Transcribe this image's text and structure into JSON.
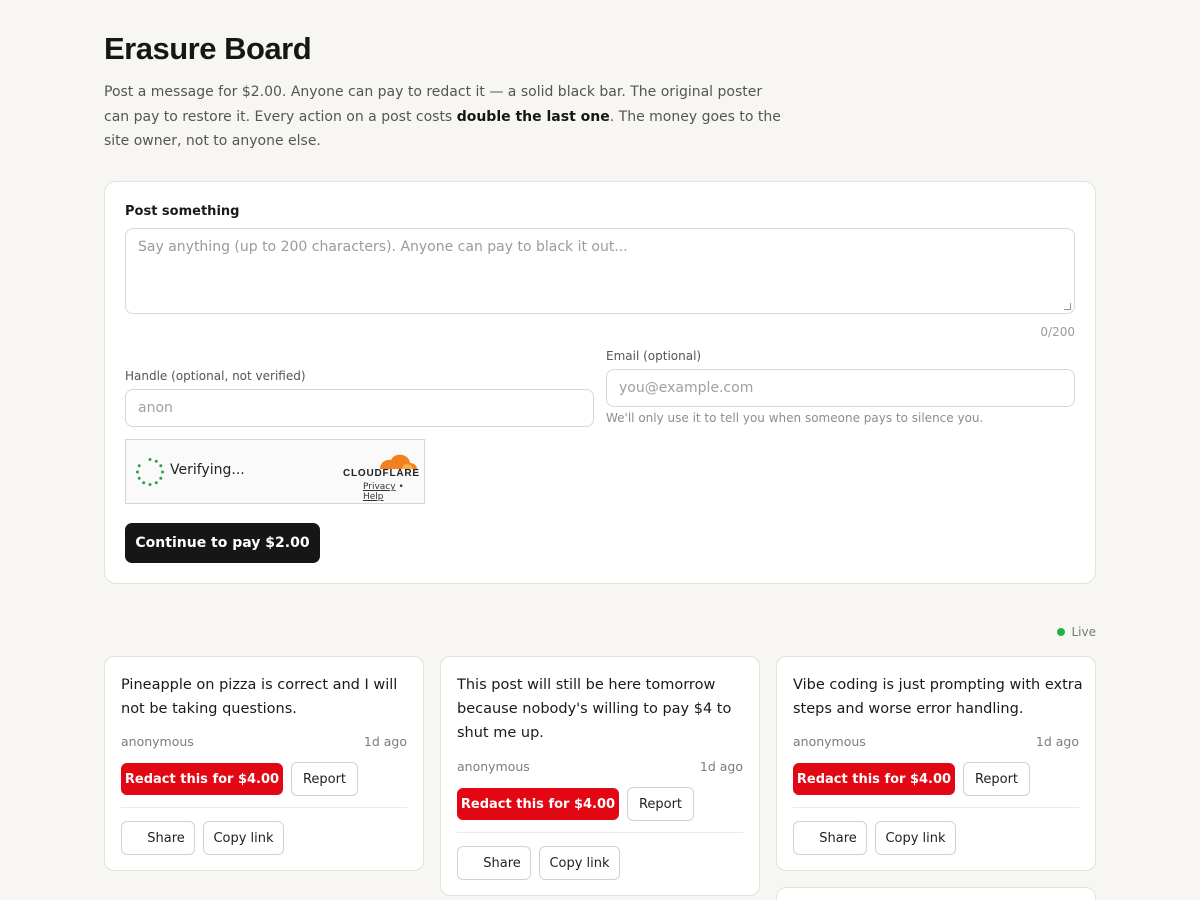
{
  "page": {
    "title": "Erasure Board",
    "intro_a": "Post a message for $2.00. Anyone can pay to redact it — a solid black bar. The original poster can pay to restore it. Every action on a post costs ",
    "intro_bold": "double the last one",
    "intro_b": ". The money goes to the site owner, not to anyone else."
  },
  "form": {
    "heading": "Post something",
    "message_placeholder": "Say anything (up to 200 characters). Anyone can pay to black it out...",
    "counter": "0/200",
    "handle_label": "Handle (optional, not verified)",
    "handle_placeholder": "anon",
    "email_label": "Email (optional)",
    "email_placeholder": "you@example.com",
    "email_hint": "We'll only use it to tell you when someone pays to silence you.",
    "captcha": {
      "status": "Verifying...",
      "brand": "CLOUDFLARE",
      "privacy": "Privacy",
      "separator": "•",
      "help": "Help"
    },
    "submit_label": "Continue to pay $2.00"
  },
  "feed": {
    "live_label": "Live",
    "share_label": "Share",
    "copy_label": "Copy link",
    "report_label": "Report",
    "posts": [
      {
        "text": "Pineapple on pizza is correct and I will not be taking questions.",
        "author": "anonymous",
        "time": "1d ago",
        "redact_label": "Redact this for $4.00"
      },
      {
        "text": "This post will still be here tomorrow because nobody's willing to pay $4 to shut me up.",
        "author": "anonymous",
        "time": "1d ago",
        "redact_label": "Redact this for $4.00"
      },
      {
        "text": "Vibe coding is just prompting with extra steps and worse error handling.",
        "author": "anonymous",
        "time": "1d ago",
        "redact_label": "Redact this for $4.00"
      }
    ]
  },
  "colors": {
    "background": "#f7f6f3",
    "primary_button": "#161616",
    "redact_button": "#e30613",
    "live_dot": "#22b04a",
    "cloudflare_orange": "#f38020"
  }
}
